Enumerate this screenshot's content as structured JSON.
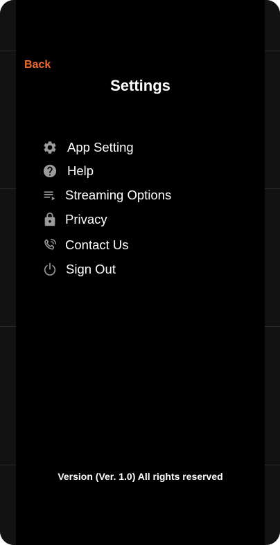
{
  "nav": {
    "back_label": "Back"
  },
  "header": {
    "title": "Settings"
  },
  "menu": {
    "items": [
      {
        "label": "App Setting",
        "icon": "gear-icon"
      },
      {
        "label": "Help",
        "icon": "help-circle-icon"
      },
      {
        "label": "Streaming Options",
        "icon": "playlist-play-icon"
      },
      {
        "label": "Privacy",
        "icon": "lock-icon"
      },
      {
        "label": "Contact Us",
        "icon": "phone-call-icon"
      },
      {
        "label": "Sign Out",
        "icon": "power-icon"
      }
    ]
  },
  "footer": {
    "version_text": "Version (Ver. 1.0) All rights reserved"
  },
  "colors": {
    "accent": "#f26a2e",
    "background": "#000000",
    "text": "#ffffff",
    "icon": "#9a9a9a"
  }
}
